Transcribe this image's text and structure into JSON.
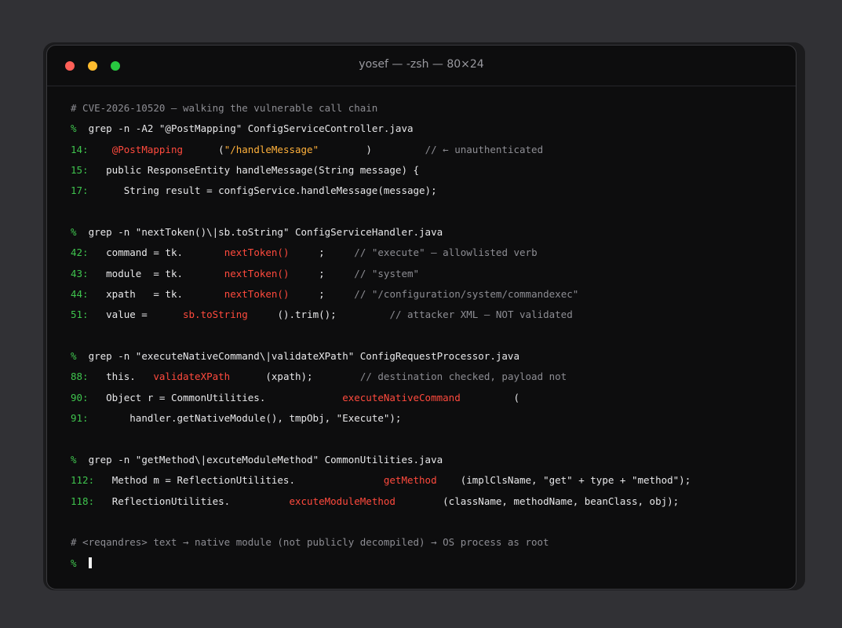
{
  "window": {
    "title": "yosef — -zsh — 80×24"
  },
  "terminal": {
    "prompt": "%",
    "lines": {
      "l1_comment": "# CVE-2026-10520 — walking the vulnerable call chain",
      "l2_cmd": "grep -n -A2 \"@PostMapping\" ConfigServiceController.java",
      "l3_num": "14:",
      "l3_a": "@PostMapping",
      "l3_b": "(",
      "l3_c": "\"/handleMessage\"",
      "l3_d": ")",
      "l3_e": "// ← unauthenticated",
      "l4_num": "15:",
      "l4_code": "public ResponseEntity handleMessage(String message) {",
      "l5_num": "17:",
      "l5_code": "String result = configService.handleMessage(message);",
      "l6_cmd": "grep -n \"nextToken()\\|sb.toString\" ConfigServiceHandler.java",
      "l7_num": "42:",
      "l7_a": "command = tk.",
      "l7_b": "nextToken()",
      "l7_c": ";",
      "l7_d": "// \"execute\" — allowlisted verb",
      "l8_num": "43:",
      "l8_a": "module  = tk.",
      "l8_b": "nextToken()",
      "l8_c": ";",
      "l8_d": "// \"system\"",
      "l9_num": "44:",
      "l9_a": "xpath   = tk.",
      "l9_b": "nextToken()",
      "l9_c": ";",
      "l9_d": "// \"/configuration/system/commandexec\"",
      "l10_num": "51:",
      "l10_a": "value =",
      "l10_b": "sb.toString",
      "l10_c": "().trim();",
      "l10_d": "// attacker XML — NOT validated",
      "l11_cmd": "grep -n \"executeNativeCommand\\|validateXPath\" ConfigRequestProcessor.java",
      "l12_num": "88:",
      "l12_a": "this.",
      "l12_b": "validateXPath",
      "l12_c": "(xpath);",
      "l12_d": "// destination checked, payload not",
      "l13_num": "90:",
      "l13_a": "Object r = CommonUtilities.",
      "l13_b": "executeNativeCommand",
      "l13_c": "(",
      "l14_num": "91:",
      "l14_code": "handler.getNativeModule(), tmpObj, \"Execute\");",
      "l15_cmd": "grep -n \"getMethod\\|excuteModuleMethod\" CommonUtilities.java",
      "l16_num": "112:",
      "l16_a": "Method m = ReflectionUtilities.",
      "l16_b": "getMethod",
      "l16_c": "(implClsName, \"get\" + type + \"method\");",
      "l17_num": "118:",
      "l17_a": "ReflectionUtilities.",
      "l17_b": "excuteModuleMethod",
      "l17_c": "(className, methodName, beanClass, obj);",
      "l18_comment": "# <reqandres> text → native module (not publicly decompiled) → OS process as root"
    }
  },
  "colors": {
    "background": "#313135",
    "window": "#0d0d0e",
    "prompt_green": "#3fc44e",
    "highlight_red": "#ff4a3d",
    "string_orange": "#ffb13b",
    "comment_gray": "#8d8d93"
  }
}
